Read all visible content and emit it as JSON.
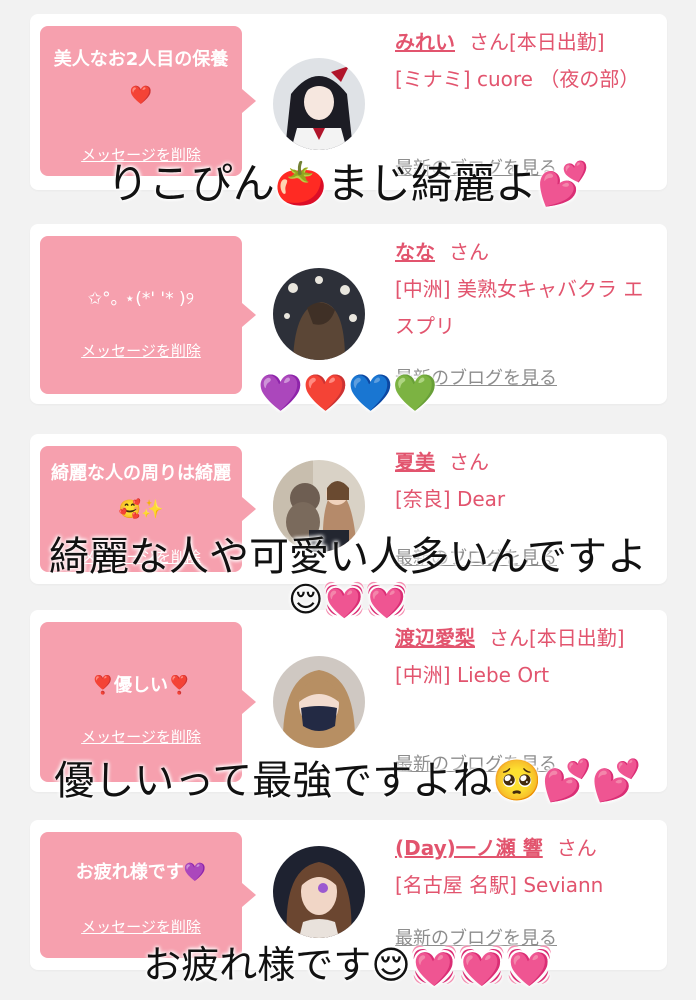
{
  "cards": [
    {
      "message": "美人なお2人目の保養",
      "message_emoji": "❤️",
      "delete_label": "メッセージを削除",
      "name": "みれい",
      "honorific": "さん[本日出勤]",
      "shop": "[ミナミ] cuore （夜の部）",
      "blog_label": "最新のブログを見る"
    },
    {
      "message": "✩°｡ ⋆(*' '* )୨",
      "delete_label": "メッセージを削除",
      "name": "なな",
      "honorific": "さん",
      "shop": "[中洲] 美熟女キャバクラ エスプリ",
      "blog_label": "最新のブログを見る"
    },
    {
      "message": "綺麗な人の周りは綺麗",
      "message_emoji": "🥰✨",
      "delete_label": "メッセージを削除",
      "name": "夏美",
      "honorific": "さん",
      "shop": "[奈良] Dear",
      "blog_label": "最新のブログを見る"
    },
    {
      "message": "優しい",
      "message_emoji_left": "❣️",
      "message_emoji": "❣️",
      "delete_label": "メッセージを削除",
      "name": "渡辺愛梨",
      "honorific": "さん[本日出勤]",
      "shop": "[中洲] Liebe Ort",
      "blog_label": "最新のブログを見る"
    },
    {
      "message": "お疲れ様です",
      "message_emoji": "💜",
      "delete_label": "メッセージを削除",
      "name": "(Day)一ノ瀬 響",
      "honorific": "さん",
      "shop": "[名古屋 名駅] Seviann",
      "blog_label": "最新のブログを見る"
    }
  ],
  "captions": [
    {
      "text": "りこぴん🍅まじ綺麗よ💕"
    },
    {
      "text": "💜❤️💙💚"
    },
    {
      "text": "綺麗な人や可愛い人多いんですよ"
    },
    {
      "text": "😌💓💓"
    },
    {
      "text": "優しいって最強ですよね🥺💕💕"
    },
    {
      "text": "お疲れ様です😌💓💓💓"
    }
  ],
  "colors": {
    "accent": "#e2546e",
    "bubble": "#f6a0ae",
    "background": "#f2f2f2",
    "link_gray": "#8d8d8d"
  }
}
